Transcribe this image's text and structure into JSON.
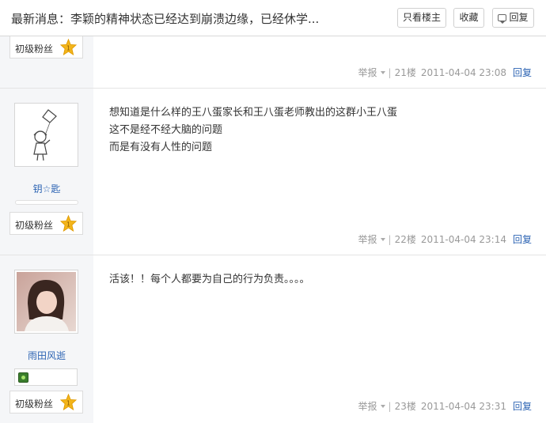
{
  "header": {
    "title": "最新消息：李颖的精神状态已经达到崩溃边缘，已经休学...",
    "only_op_label": "只看楼主",
    "favorite_label": "收藏",
    "reply_label": "回复"
  },
  "posts": [
    {
      "level_label": "初级粉丝",
      "level_num": "1",
      "report_label": "举报",
      "floor": "21楼",
      "time": "2011-04-04 23:08",
      "reply_label": "回复"
    },
    {
      "username": "钥☆匙",
      "avatar_icon": "girl-kite-sketch-avatar",
      "level_label": "初级粉丝",
      "level_num": "1",
      "content_lines": [
        "想知道是什么样的王八蛋家长和王八蛋老师教出的这群小王八蛋",
        "这不是经不经大脑的问题",
        "而是有没有人性的问题"
      ],
      "report_label": "举报",
      "floor": "22楼",
      "time": "2011-04-04 23:14",
      "reply_label": "回复"
    },
    {
      "username": "雨田风逝",
      "avatar_icon": "girl-photo-avatar",
      "badge_icon": "member-gem-icon",
      "level_label": "初级粉丝",
      "level_num": "1",
      "content_lines": [
        "活该！！每个人都要为自己的行为负责。。。。"
      ],
      "report_label": "举报",
      "floor": "23楼",
      "time": "2011-04-04 23:31",
      "reply_label": "回复"
    }
  ],
  "colors": {
    "link_blue": "#2d64b3",
    "sidebar_bg": "#f5f6f8",
    "star_gold": "#f3b51b"
  }
}
